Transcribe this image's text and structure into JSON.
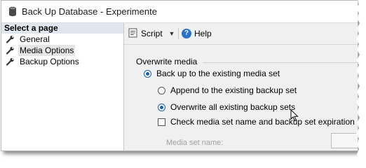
{
  "window": {
    "title": "Back Up Database - Experimente",
    "icon": "database-icon"
  },
  "left_pane": {
    "header": "Select a page",
    "items": [
      {
        "label": "General",
        "icon": "wrench-icon",
        "selected": false
      },
      {
        "label": "Media Options",
        "icon": "wrench-icon",
        "selected": true
      },
      {
        "label": "Backup Options",
        "icon": "wrench-icon",
        "selected": false
      }
    ]
  },
  "toolbar": {
    "script_label": "Script",
    "script_icon": "script-icon",
    "dropdown_icon": "chevron-down-icon",
    "help_label": "Help",
    "help_icon": "help-icon"
  },
  "overwrite_media": {
    "section_label": "Overwrite media",
    "backup_existing": {
      "label": "Back up to the existing media set",
      "checked": true
    },
    "append": {
      "label": "Append to the existing backup set",
      "checked": false
    },
    "overwrite": {
      "label": "Overwrite all existing backup sets",
      "checked": true
    },
    "check_media": {
      "label": "Check media set name and backup set expiration",
      "checked": false
    },
    "media_set_name_label": "Media set name:",
    "media_set_name_value": ""
  },
  "colors": {
    "accent": "#1a5fb4",
    "help_blue": "#2a72c9",
    "pane_header_bg": "#dfe6ee"
  }
}
